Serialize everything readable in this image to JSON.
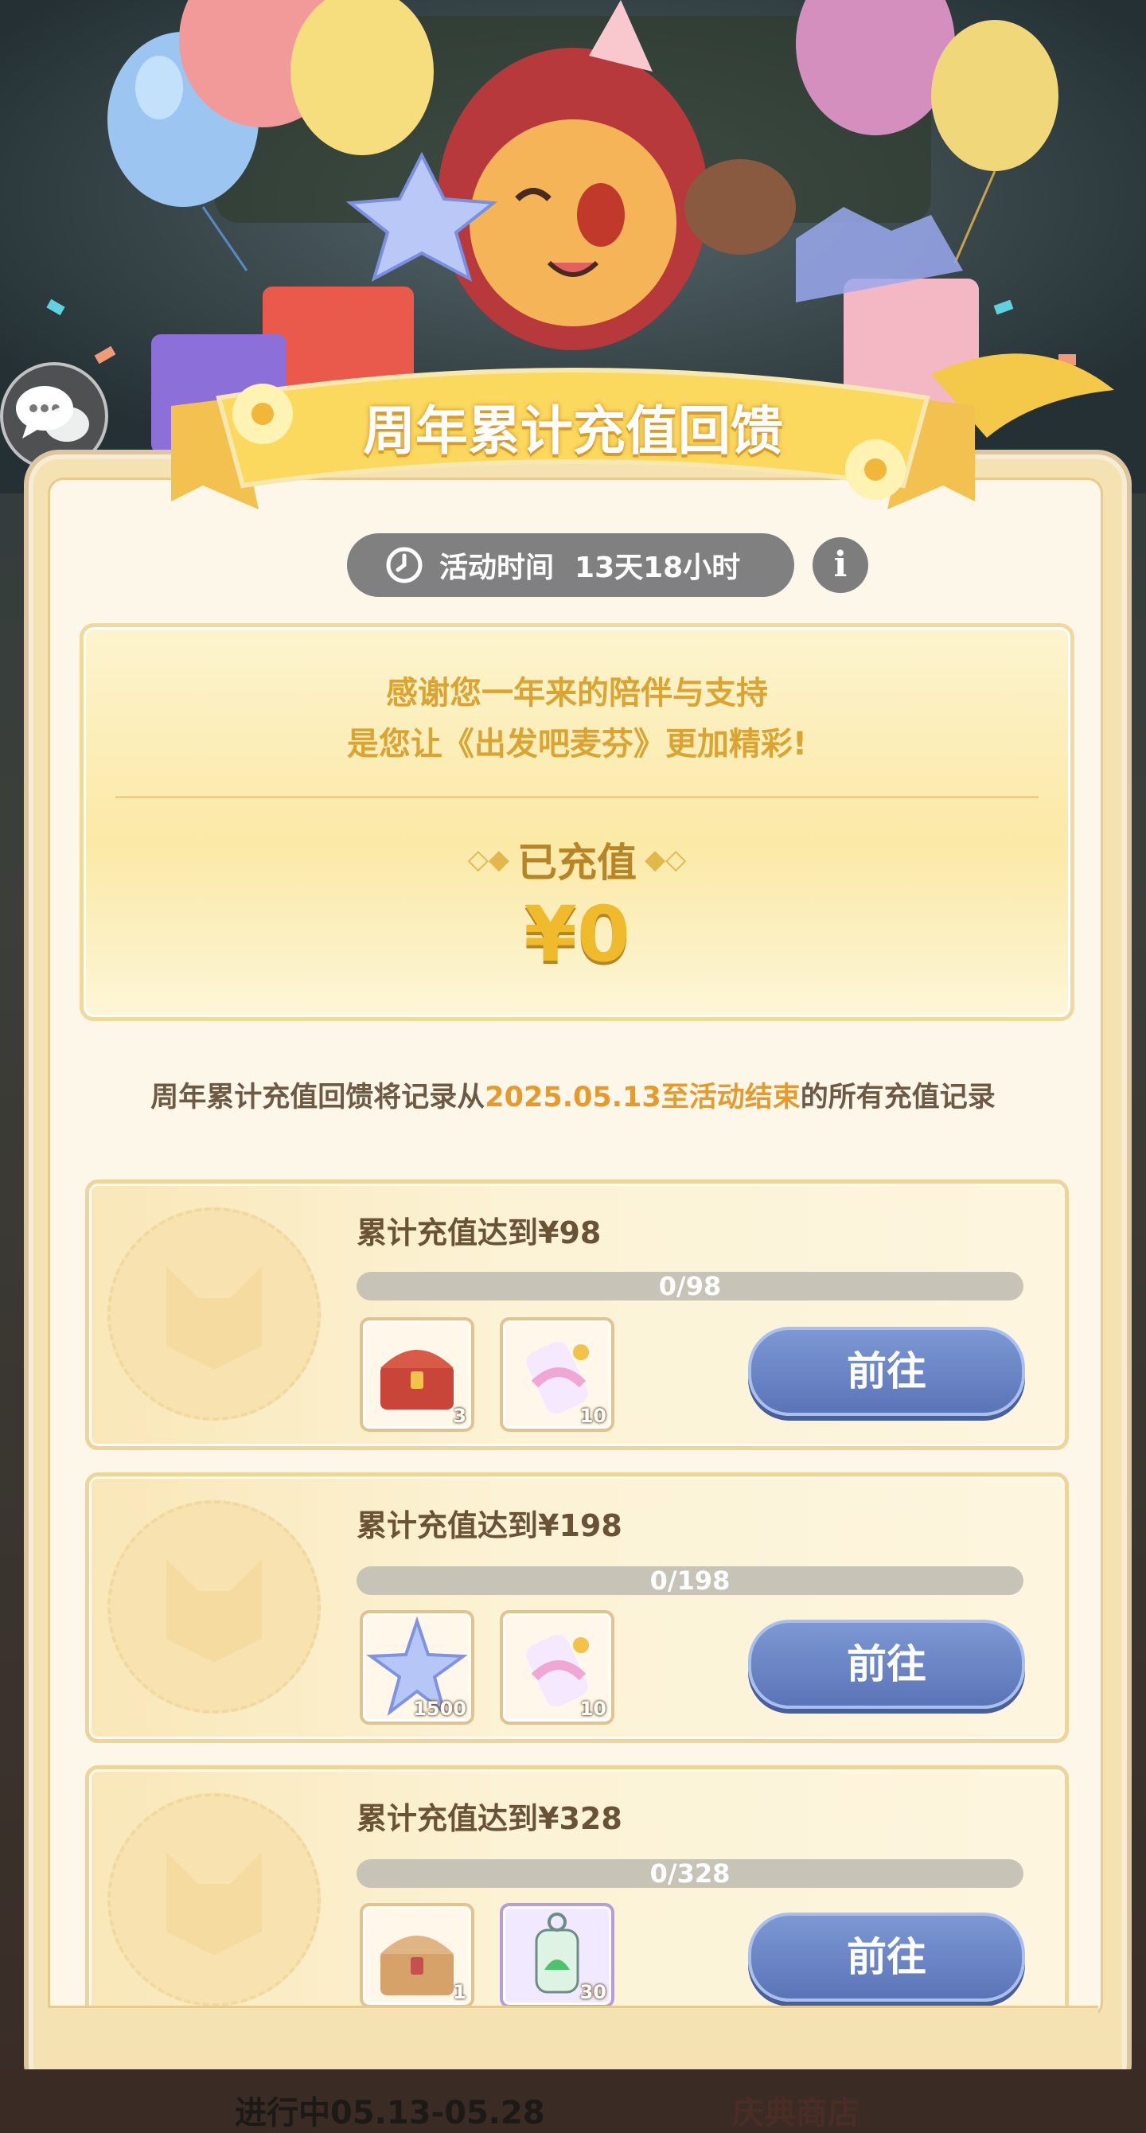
{
  "banner": {
    "title": "周年累计充值回馈"
  },
  "timer": {
    "label": "活动时间",
    "value": "13天18小时",
    "info_icon": "i"
  },
  "thanks": {
    "line1": "感谢您一年来的陪伴与支持",
    "line2": "是您让《出发吧麦芬》更加精彩!",
    "recharged_label": "已充值",
    "recharged_amount": "¥0"
  },
  "note": {
    "prefix": "周年累计充值回馈将记录从",
    "highlight": "2025.05.13至活动结束",
    "suffix": "的所有充值记录"
  },
  "tiers": [
    {
      "title": "累计充值达到¥98",
      "progress_text": "0/98",
      "progress": 0,
      "items": [
        {
          "icon": "treasure-chest-icon",
          "count": "3"
        },
        {
          "icon": "paint-bottle-icon",
          "count": "10"
        }
      ],
      "button": "前往"
    },
    {
      "title": "累计充值达到¥198",
      "progress_text": "0/198",
      "progress": 0,
      "items": [
        {
          "icon": "star-crystal-icon",
          "count": "1500"
        },
        {
          "icon": "paint-bottle-icon",
          "count": "10"
        }
      ],
      "button": "前往"
    },
    {
      "title": "累计充值达到¥328",
      "progress_text": "0/328",
      "progress": 0,
      "items": [
        {
          "icon": "treasure-chest-icon",
          "count": "1"
        },
        {
          "icon": "green-potion-icon",
          "count": "30"
        }
      ],
      "button": "前往"
    }
  ],
  "footer": {
    "status": "进行中05.13-05.28",
    "shop": "庆典商店"
  },
  "colors": {
    "gold": "#dba432",
    "button_blue": "#6681c4",
    "panel": "#fdf7ea"
  }
}
